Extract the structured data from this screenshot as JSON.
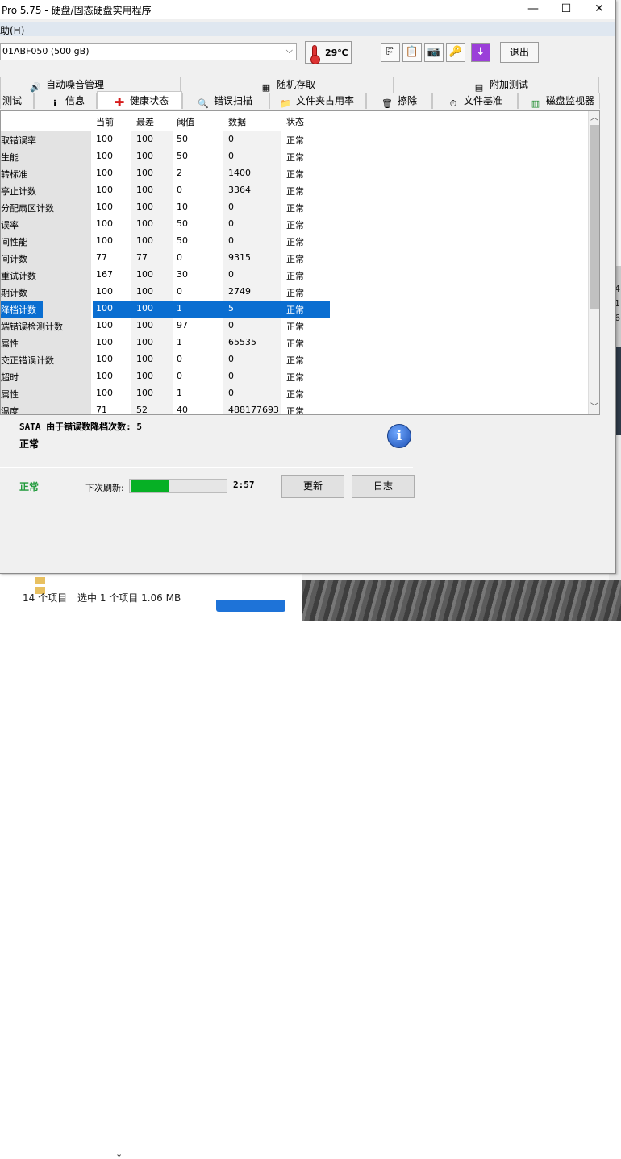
{
  "window": {
    "title": "Pro 5.75 - 硬盘/固态硬盘实用程序",
    "controls": {
      "minimize": "—",
      "maximize": "☐",
      "close": "✕"
    }
  },
  "menu": {
    "help_label": "助(H)"
  },
  "toolbar": {
    "drive": "01ABF050 (500 gB)",
    "temperature": "29℃",
    "exit_label": "退出",
    "icons": [
      "copy-icon",
      "paste-icon",
      "camera-icon",
      "keys-icon",
      "download-icon"
    ]
  },
  "tabs_top": [
    {
      "label": "自动噪音管理",
      "icon": "speaker-icon"
    },
    {
      "label": "随机存取",
      "icon": "chart-icon"
    },
    {
      "label": "附加测试",
      "icon": "test-icon"
    }
  ],
  "tabs_bottom": [
    {
      "label": "测试",
      "icon": ""
    },
    {
      "label": "信息",
      "icon": "info-icon"
    },
    {
      "label": "健康状态",
      "icon": "health-cross-icon",
      "active": true
    },
    {
      "label": "错误扫描",
      "icon": "magnifier-icon"
    },
    {
      "label": "文件夹占用率",
      "icon": "folder-icon"
    },
    {
      "label": "擦除",
      "icon": "trash-icon"
    },
    {
      "label": "文件基准",
      "icon": "benchmark-icon"
    },
    {
      "label": "磁盘监视器",
      "icon": "monitor-icon"
    }
  ],
  "table": {
    "headers": [
      "当前",
      "最差",
      "阈值",
      "数据",
      "状态"
    ],
    "rows": [
      [
        "读取错误率",
        "100",
        "100",
        "50",
        "0",
        "正常"
      ],
      [
        "吞吐性能",
        "100",
        "100",
        "50",
        "0",
        "正常"
      ],
      [
        "旋转标准",
        "100",
        "100",
        "2",
        "1400",
        "正常"
      ],
      [
        "启停止计数",
        "100",
        "100",
        "0",
        "3364",
        "正常"
      ],
      [
        "重分配扇区计数",
        "100",
        "100",
        "10",
        "0",
        "正常"
      ],
      [
        "寻道错误率",
        "100",
        "100",
        "50",
        "0",
        "正常"
      ],
      [
        "寻道时间性能",
        "100",
        "100",
        "50",
        "0",
        "正常"
      ],
      [
        "通电时间计数",
        "77",
        "77",
        "0",
        "9315",
        "正常"
      ],
      [
        "旋转重试计数",
        "167",
        "100",
        "30",
        "0",
        "正常"
      ],
      [
        "电源周期计数",
        "100",
        "100",
        "0",
        "2749",
        "正常"
      ],
      [
        "SATA 降档计数",
        "100",
        "100",
        "1",
        "5",
        "正常"
      ],
      [
        "端到端错误检测计数",
        "100",
        "100",
        "97",
        "0",
        "正常"
      ],
      [
        "报告属性",
        "100",
        "100",
        "1",
        "65535",
        "正常"
      ],
      [
        "不可校正错误计数",
        "100",
        "100",
        "0",
        "0",
        "正常"
      ],
      [
        "命令超时",
        "100",
        "100",
        "0",
        "0",
        "正常"
      ],
      [
        "厂商属性",
        "100",
        "100",
        "1",
        "0",
        "正常"
      ],
      [
        "温度",
        "71",
        "52",
        "40",
        "488177693",
        "正常"
      ]
    ],
    "row_names_visible": [
      "取错误率",
      "生能",
      "转标准",
      "亭止计数",
      "分配扇区计数",
      "误率",
      "间性能",
      "间计数",
      "重试计数",
      "期计数",
      "降档计数",
      "端错误检测计数",
      "属性",
      "交正错误计数",
      "超时",
      "属性",
      "温度"
    ],
    "selected_row": 10
  },
  "detail": {
    "title": "SATA 由于错误数降档次数: 5",
    "status": "正常"
  },
  "bottom": {
    "overall_status": "正常",
    "next_refresh_label": "下次刷新:",
    "refresh_progress": 0.4,
    "countdown": "2:57",
    "update_label": "更新",
    "log_label": "日志"
  },
  "background": {
    "item_count": "14 个项目",
    "selection": "选中 1 个项目  1.06 MB",
    "side_digits": [
      "4",
      "1",
      "6"
    ]
  },
  "colors": {
    "selection": "#0a6ed1",
    "ok_green": "#1f9a3a",
    "progress": "#06b025"
  }
}
